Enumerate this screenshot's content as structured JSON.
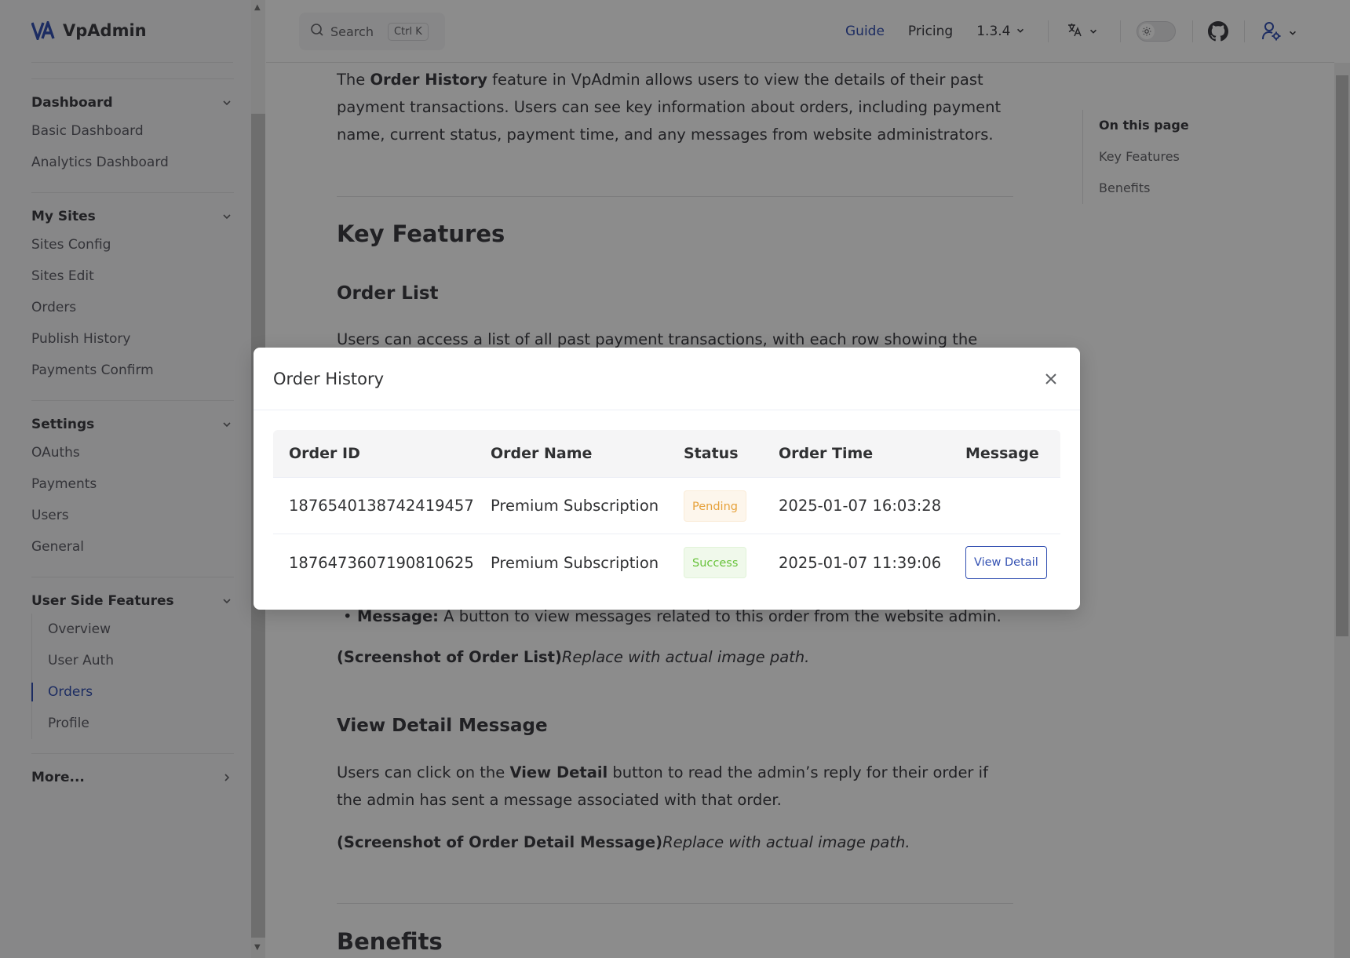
{
  "brand": {
    "name": "VpAdmin",
    "accent": "#3451b2"
  },
  "topbar": {
    "search_label": "Search",
    "search_shortcut": "Ctrl K",
    "nav": [
      {
        "label": "Guide",
        "active": true
      },
      {
        "label": "Pricing",
        "active": false
      }
    ],
    "version": "1.3.4"
  },
  "sidebar": {
    "groups": [
      {
        "title": "Dashboard",
        "items": [
          "Basic Dashboard",
          "Analytics Dashboard"
        ]
      },
      {
        "title": "My Sites",
        "items": [
          "Sites Config",
          "Sites Edit",
          "Orders",
          "Publish History",
          "Payments Confirm"
        ]
      },
      {
        "title": "Settings",
        "items": [
          "OAuths",
          "Payments",
          "Users",
          "General"
        ]
      },
      {
        "title": "User Side Features",
        "items": [
          "Overview",
          "User Auth",
          "Orders",
          "Profile"
        ],
        "active_item": "Orders"
      }
    ],
    "more": "More..."
  },
  "content": {
    "intro": {
      "t1": "The ",
      "b1": "Order History",
      "t2": " feature in VpAdmin allows users to view the details of their past payment transactions. Users can see key information about orders, including payment name, current status, payment time, and any messages from website administrators."
    },
    "h_key_features": "Key Features",
    "h_order_list": "Order List",
    "order_list_text": "Users can access a list of all past payment transactions, with each row showing the",
    "bullet_message_bold": "Message:",
    "bullet_message_text": " A button to view messages related to this order from the website admin.",
    "screenshot1_bold": "(Screenshot of Order List)",
    "screenshot1_italic": "Replace with actual image path.",
    "h_view_detail": "View Detail Message",
    "view_detail_t1": "Users can click on the ",
    "view_detail_b": "View Detail",
    "view_detail_t2": " button to read the admin’s reply for their order if the admin has sent a message associated with that order.",
    "screenshot2_bold": "(Screenshot of Order Detail Message)",
    "screenshot2_italic": "Replace with actual image path.",
    "h_benefits": "Benefits"
  },
  "outline": {
    "title": "On this page",
    "items": [
      "Key Features",
      "Benefits"
    ]
  },
  "modal": {
    "title": "Order History",
    "columns": [
      "Order ID",
      "Order Name",
      "Status",
      "Order Time",
      "Message"
    ],
    "rows": [
      {
        "id": "1876540138742419457",
        "name": "Premium Subscription",
        "status": "Pending",
        "time": "2025-01-07 16:03:28",
        "message": ""
      },
      {
        "id": "1876473607190810625",
        "name": "Premium Subscription",
        "status": "Success",
        "time": "2025-01-07 11:39:06",
        "message": "View Detail"
      }
    ]
  }
}
